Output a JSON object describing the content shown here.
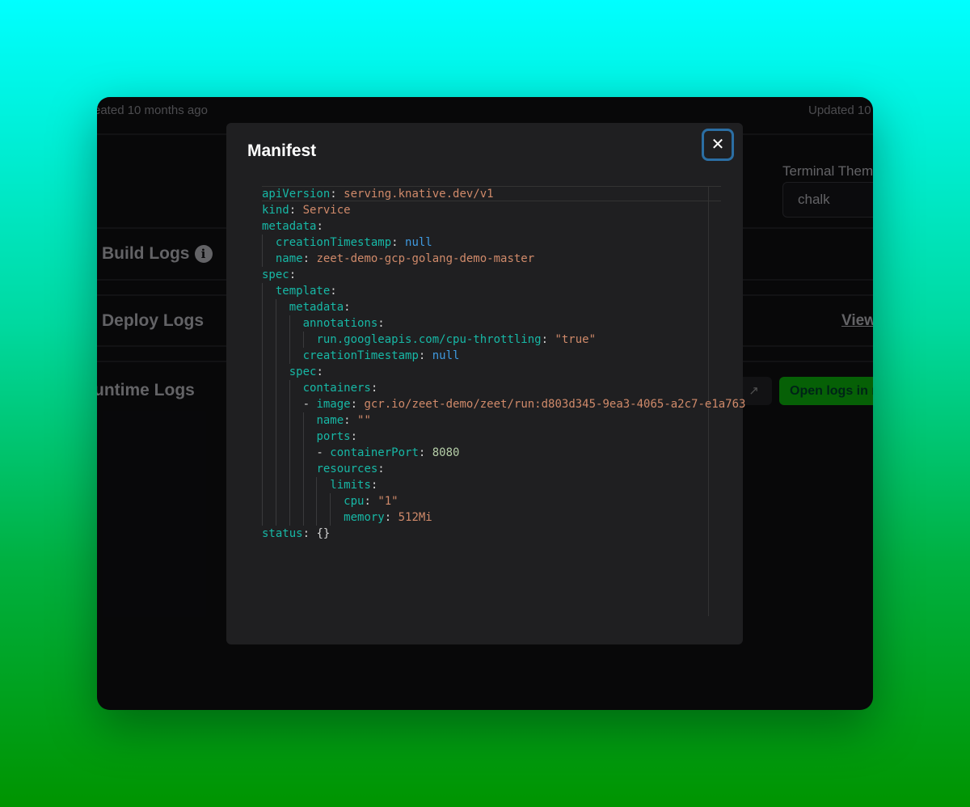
{
  "background": {
    "created": "eated 10 months ago",
    "updated": "Updated 10",
    "terminal_theme_label": "Terminal Theme",
    "terminal_theme_value": "chalk",
    "build_logs": "Build Logs",
    "build_logs_info": "i",
    "deploy_logs": "Deploy Logs",
    "view_link": "View",
    "runtime_logs": "untime Logs",
    "open_logs_button": "Open logs in n",
    "external_icon": "↗"
  },
  "modal": {
    "title": "Manifest",
    "close_icon": "✕",
    "lines": [
      {
        "i": 0,
        "k": "apiVersion",
        "v": "serving.knative.dev/v1",
        "t": "s"
      },
      {
        "i": 0,
        "k": "kind",
        "v": "Service",
        "t": "s"
      },
      {
        "i": 0,
        "k": "metadata"
      },
      {
        "i": 1,
        "k": "creationTimestamp",
        "v": "null",
        "t": "n"
      },
      {
        "i": 1,
        "k": "name",
        "v": "zeet-demo-gcp-golang-demo-master",
        "t": "s"
      },
      {
        "i": 0,
        "k": "spec"
      },
      {
        "i": 1,
        "k": "template"
      },
      {
        "i": 2,
        "k": "metadata"
      },
      {
        "i": 3,
        "k": "annotations"
      },
      {
        "i": 4,
        "k": "run.googleapis.com/cpu-throttling",
        "v": "\"true\"",
        "t": "s"
      },
      {
        "i": 3,
        "k": "creationTimestamp",
        "v": "null",
        "t": "n"
      },
      {
        "i": 2,
        "k": "spec"
      },
      {
        "i": 3,
        "k": "containers"
      },
      {
        "i": 3,
        "d": true,
        "k": "image",
        "v": "gcr.io/zeet-demo/zeet/run:d803d345-9ea3-4065-a2c7-e1a763",
        "t": "s"
      },
      {
        "i": 4,
        "k": "name",
        "v": "\"\"",
        "t": "s"
      },
      {
        "i": 4,
        "k": "ports"
      },
      {
        "i": 4,
        "d": true,
        "k": "containerPort",
        "v": "8080",
        "t": "num"
      },
      {
        "i": 4,
        "k": "resources"
      },
      {
        "i": 5,
        "k": "limits"
      },
      {
        "i": 6,
        "k": "cpu",
        "v": "\"1\"",
        "t": "s"
      },
      {
        "i": 6,
        "k": "memory",
        "v": "512Mi",
        "t": "s"
      },
      {
        "i": 0,
        "k": "status",
        "v": "{}",
        "t": "p"
      }
    ]
  }
}
